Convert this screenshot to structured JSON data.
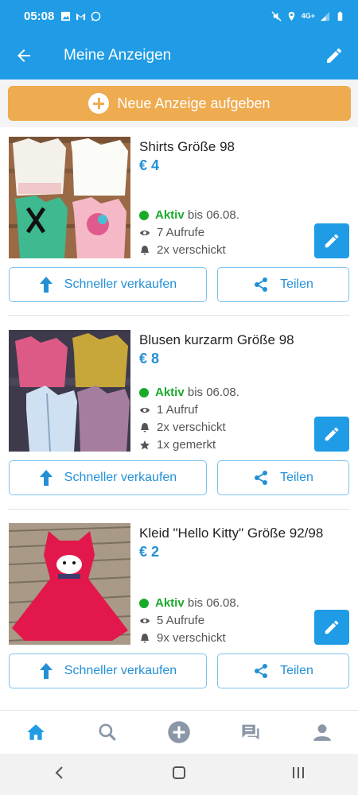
{
  "status_bar": {
    "time": "05:08",
    "icons_left": [
      "image-icon",
      "gmail-icon",
      "whatsapp-icon"
    ],
    "icons_right": [
      "mute-icon",
      "location-icon",
      "4g-signal-icon",
      "battery-icon"
    ],
    "network": "4G+"
  },
  "app_bar": {
    "title": "Meine Anzeigen",
    "color": "#1f9ce5"
  },
  "new_ad_button": {
    "label": "Neue Anzeige aufgeben",
    "color": "#efab50"
  },
  "listings": [
    {
      "title": "Shirts Größe 98",
      "price": "€ 4",
      "status": "Aktiv",
      "until": "bis 06.08.",
      "stats": [
        {
          "icon": "eye-icon",
          "text": "7 Aufrufe"
        },
        {
          "icon": "bell-icon",
          "text": "2x verschickt"
        }
      ],
      "sell_faster_label": "Schneller verkaufen",
      "share_label": "Teilen"
    },
    {
      "title": "Blusen kurzarm Größe 98",
      "price": "€ 8",
      "status": "Aktiv",
      "until": "bis 06.08.",
      "stats": [
        {
          "icon": "eye-icon",
          "text": "1 Aufruf"
        },
        {
          "icon": "bell-icon",
          "text": "2x verschickt"
        },
        {
          "icon": "star-icon",
          "text": "1x gemerkt"
        }
      ],
      "sell_faster_label": "Schneller verkaufen",
      "share_label": "Teilen"
    },
    {
      "title": "Kleid \"Hello Kitty\" Größe 92/98",
      "price": "€ 2",
      "status": "Aktiv",
      "until": "bis 06.08.",
      "stats": [
        {
          "icon": "eye-icon",
          "text": "5 Aufrufe"
        },
        {
          "icon": "bell-icon",
          "text": "9x verschickt"
        }
      ],
      "sell_faster_label": "Schneller verkaufen",
      "share_label": "Teilen"
    }
  ],
  "bottom_nav": [
    "home-icon",
    "search-icon",
    "add-icon",
    "messages-icon",
    "profile-icon"
  ],
  "colors": {
    "accent": "#1f9ce5",
    "price": "#2390d6",
    "active": "#1aaa2a"
  }
}
